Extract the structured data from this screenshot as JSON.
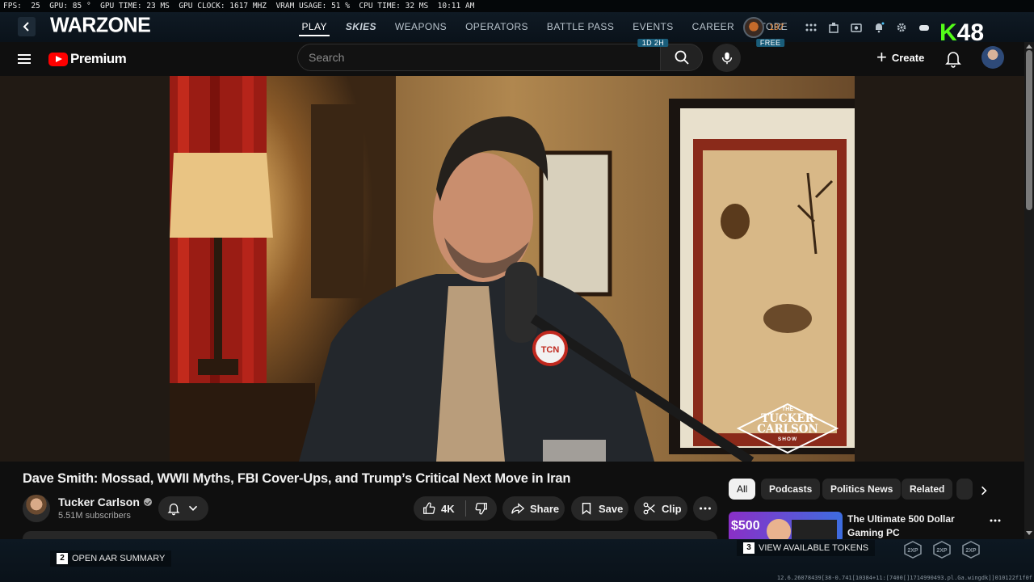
{
  "overlay": {
    "perf_text": "FPS:  25  GPU: 85 °  GPU TIME: 23 MS  GPU CLOCK: 1617 MHZ  VRAM USAGE: 51 %  CPU TIME: 32 MS  10:11 AM"
  },
  "warzone": {
    "logo": "WARZONE",
    "nav": [
      {
        "label": "PLAY",
        "sub": ""
      },
      {
        "label": "SKIES",
        "sub": ""
      },
      {
        "label": "WEAPONS",
        "sub": ""
      },
      {
        "label": "OPERATORS",
        "sub": ""
      },
      {
        "label": "BATTLE PASS",
        "sub": ""
      },
      {
        "label": "EVENTS",
        "sub": "1D 2H"
      },
      {
        "label": "CAREER",
        "sub": ""
      },
      {
        "label": "STORE",
        "sub": "FREE"
      }
    ],
    "count": "197",
    "kick_number": "48"
  },
  "youtube": {
    "brand": "Premium",
    "search_placeholder": "Search",
    "create_label": "Create",
    "video": {
      "title": "Dave Smith: Mossad, WWII Myths, FBI Cover-Ups, and Trump’s Critical Next Move in Iran",
      "channel": "Tucker Carlson",
      "subscribers": "5.51M subscribers",
      "likes": "4K",
      "share_label": "Share",
      "save_label": "Save",
      "clip_label": "Clip",
      "watermark_the": "THE",
      "watermark_name": "TUCKER CARLSON",
      "watermark_show": "SHOW",
      "mic_flag": "TCN"
    },
    "chips": [
      "All",
      "Podcasts",
      "Politics News",
      "Related"
    ],
    "related": [
      {
        "title": "The Ultimate 500 Dollar Gaming PC",
        "thumb_badge": "$500"
      }
    ]
  },
  "bottom_bar": {
    "aar_key": "2",
    "aar_label": "OPEN AAR SUMMARY",
    "tokens_key": "3",
    "tokens_label": "VIEW AVAILABLE TOKENS",
    "build": "12.6.26078439[38-0.741[10384+11:[7400[]1714990493.pl.Ga.wingdk]]010122f1f0f"
  },
  "colors": {
    "youtube_red": "#ff0000",
    "kick_green": "#53fc18",
    "cod_orange": "#e98a3a"
  }
}
